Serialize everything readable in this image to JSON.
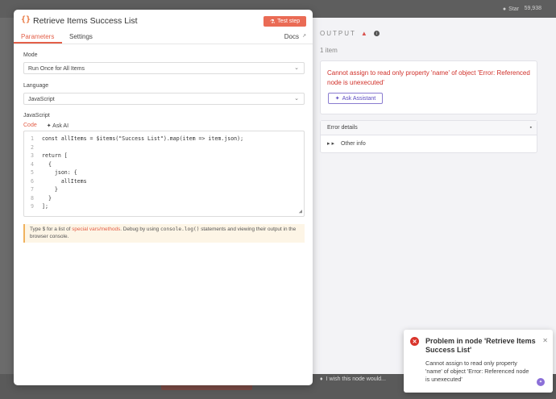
{
  "topbar": {
    "star_label": "Star",
    "star_count": "59,938"
  },
  "panel": {
    "title": "Retrieve Items Success List",
    "test_step_label": "Test step",
    "tabs": {
      "parameters": "Parameters",
      "settings": "Settings",
      "docs": "Docs"
    },
    "mode": {
      "label": "Mode",
      "value": "Run Once for All Items"
    },
    "language": {
      "label": "Language",
      "value": "JavaScript"
    },
    "javascript_label": "JavaScript",
    "code_tabs": {
      "code": "Code",
      "ask_ai": "Ask AI"
    },
    "code_lines": [
      "const allItems = $items(\"Success List\").map(item => item.json);",
      "",
      "return [",
      "  {",
      "    json: {",
      "      allItems",
      "    }",
      "  }",
      "];"
    ],
    "line_numbers": [
      "1",
      "2",
      "3",
      "4",
      "5",
      "6",
      "7",
      "8",
      "9"
    ],
    "hint": {
      "prefix": "Type $ for a list of ",
      "link": "special vars/methods",
      "middle": ". Debug by using ",
      "code": "console.log()",
      "suffix": " statements and viewing their output in the browser console."
    }
  },
  "output": {
    "header": "OUTPUT",
    "item_count": "1 item",
    "error_message": "Cannot assign to read only property 'name' of object 'Error: Referenced node is unexecuted'",
    "ask_assistant": "Ask Assistant",
    "error_details": "Error details",
    "other_info": "Other info"
  },
  "footer": {
    "wish": "I wish this node would..."
  },
  "toast": {
    "title": "Problem in node 'Retrieve Items Success List'",
    "body": "Cannot assign to read only property 'name' of object 'Error: Referenced node is unexecuted'"
  },
  "colors": {
    "accent": "#e35f48",
    "error": "#d0302a",
    "assistant": "#5b49c0"
  }
}
